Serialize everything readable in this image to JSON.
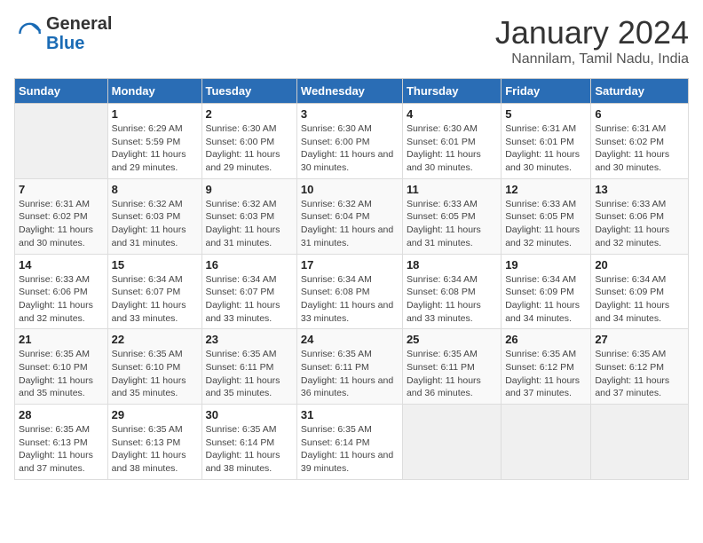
{
  "logo": {
    "text_general": "General",
    "text_blue": "Blue"
  },
  "title": "January 2024",
  "subtitle": "Nannilam, Tamil Nadu, India",
  "days_header": [
    "Sunday",
    "Monday",
    "Tuesday",
    "Wednesday",
    "Thursday",
    "Friday",
    "Saturday"
  ],
  "weeks": [
    [
      {
        "num": "",
        "empty": true
      },
      {
        "num": "1",
        "sunrise": "Sunrise: 6:29 AM",
        "sunset": "Sunset: 5:59 PM",
        "daylight": "Daylight: 11 hours and 29 minutes."
      },
      {
        "num": "2",
        "sunrise": "Sunrise: 6:30 AM",
        "sunset": "Sunset: 6:00 PM",
        "daylight": "Daylight: 11 hours and 29 minutes."
      },
      {
        "num": "3",
        "sunrise": "Sunrise: 6:30 AM",
        "sunset": "Sunset: 6:00 PM",
        "daylight": "Daylight: 11 hours and 30 minutes."
      },
      {
        "num": "4",
        "sunrise": "Sunrise: 6:30 AM",
        "sunset": "Sunset: 6:01 PM",
        "daylight": "Daylight: 11 hours and 30 minutes."
      },
      {
        "num": "5",
        "sunrise": "Sunrise: 6:31 AM",
        "sunset": "Sunset: 6:01 PM",
        "daylight": "Daylight: 11 hours and 30 minutes."
      },
      {
        "num": "6",
        "sunrise": "Sunrise: 6:31 AM",
        "sunset": "Sunset: 6:02 PM",
        "daylight": "Daylight: 11 hours and 30 minutes."
      }
    ],
    [
      {
        "num": "7",
        "sunrise": "Sunrise: 6:31 AM",
        "sunset": "Sunset: 6:02 PM",
        "daylight": "Daylight: 11 hours and 30 minutes."
      },
      {
        "num": "8",
        "sunrise": "Sunrise: 6:32 AM",
        "sunset": "Sunset: 6:03 PM",
        "daylight": "Daylight: 11 hours and 31 minutes."
      },
      {
        "num": "9",
        "sunrise": "Sunrise: 6:32 AM",
        "sunset": "Sunset: 6:03 PM",
        "daylight": "Daylight: 11 hours and 31 minutes."
      },
      {
        "num": "10",
        "sunrise": "Sunrise: 6:32 AM",
        "sunset": "Sunset: 6:04 PM",
        "daylight": "Daylight: 11 hours and 31 minutes."
      },
      {
        "num": "11",
        "sunrise": "Sunrise: 6:33 AM",
        "sunset": "Sunset: 6:05 PM",
        "daylight": "Daylight: 11 hours and 31 minutes."
      },
      {
        "num": "12",
        "sunrise": "Sunrise: 6:33 AM",
        "sunset": "Sunset: 6:05 PM",
        "daylight": "Daylight: 11 hours and 32 minutes."
      },
      {
        "num": "13",
        "sunrise": "Sunrise: 6:33 AM",
        "sunset": "Sunset: 6:06 PM",
        "daylight": "Daylight: 11 hours and 32 minutes."
      }
    ],
    [
      {
        "num": "14",
        "sunrise": "Sunrise: 6:33 AM",
        "sunset": "Sunset: 6:06 PM",
        "daylight": "Daylight: 11 hours and 32 minutes."
      },
      {
        "num": "15",
        "sunrise": "Sunrise: 6:34 AM",
        "sunset": "Sunset: 6:07 PM",
        "daylight": "Daylight: 11 hours and 33 minutes."
      },
      {
        "num": "16",
        "sunrise": "Sunrise: 6:34 AM",
        "sunset": "Sunset: 6:07 PM",
        "daylight": "Daylight: 11 hours and 33 minutes."
      },
      {
        "num": "17",
        "sunrise": "Sunrise: 6:34 AM",
        "sunset": "Sunset: 6:08 PM",
        "daylight": "Daylight: 11 hours and 33 minutes."
      },
      {
        "num": "18",
        "sunrise": "Sunrise: 6:34 AM",
        "sunset": "Sunset: 6:08 PM",
        "daylight": "Daylight: 11 hours and 33 minutes."
      },
      {
        "num": "19",
        "sunrise": "Sunrise: 6:34 AM",
        "sunset": "Sunset: 6:09 PM",
        "daylight": "Daylight: 11 hours and 34 minutes."
      },
      {
        "num": "20",
        "sunrise": "Sunrise: 6:34 AM",
        "sunset": "Sunset: 6:09 PM",
        "daylight": "Daylight: 11 hours and 34 minutes."
      }
    ],
    [
      {
        "num": "21",
        "sunrise": "Sunrise: 6:35 AM",
        "sunset": "Sunset: 6:10 PM",
        "daylight": "Daylight: 11 hours and 35 minutes."
      },
      {
        "num": "22",
        "sunrise": "Sunrise: 6:35 AM",
        "sunset": "Sunset: 6:10 PM",
        "daylight": "Daylight: 11 hours and 35 minutes."
      },
      {
        "num": "23",
        "sunrise": "Sunrise: 6:35 AM",
        "sunset": "Sunset: 6:11 PM",
        "daylight": "Daylight: 11 hours and 35 minutes."
      },
      {
        "num": "24",
        "sunrise": "Sunrise: 6:35 AM",
        "sunset": "Sunset: 6:11 PM",
        "daylight": "Daylight: 11 hours and 36 minutes."
      },
      {
        "num": "25",
        "sunrise": "Sunrise: 6:35 AM",
        "sunset": "Sunset: 6:11 PM",
        "daylight": "Daylight: 11 hours and 36 minutes."
      },
      {
        "num": "26",
        "sunrise": "Sunrise: 6:35 AM",
        "sunset": "Sunset: 6:12 PM",
        "daylight": "Daylight: 11 hours and 37 minutes."
      },
      {
        "num": "27",
        "sunrise": "Sunrise: 6:35 AM",
        "sunset": "Sunset: 6:12 PM",
        "daylight": "Daylight: 11 hours and 37 minutes."
      }
    ],
    [
      {
        "num": "28",
        "sunrise": "Sunrise: 6:35 AM",
        "sunset": "Sunset: 6:13 PM",
        "daylight": "Daylight: 11 hours and 37 minutes."
      },
      {
        "num": "29",
        "sunrise": "Sunrise: 6:35 AM",
        "sunset": "Sunset: 6:13 PM",
        "daylight": "Daylight: 11 hours and 38 minutes."
      },
      {
        "num": "30",
        "sunrise": "Sunrise: 6:35 AM",
        "sunset": "Sunset: 6:14 PM",
        "daylight": "Daylight: 11 hours and 38 minutes."
      },
      {
        "num": "31",
        "sunrise": "Sunrise: 6:35 AM",
        "sunset": "Sunset: 6:14 PM",
        "daylight": "Daylight: 11 hours and 39 minutes."
      },
      {
        "num": "",
        "empty": true
      },
      {
        "num": "",
        "empty": true
      },
      {
        "num": "",
        "empty": true
      }
    ]
  ]
}
